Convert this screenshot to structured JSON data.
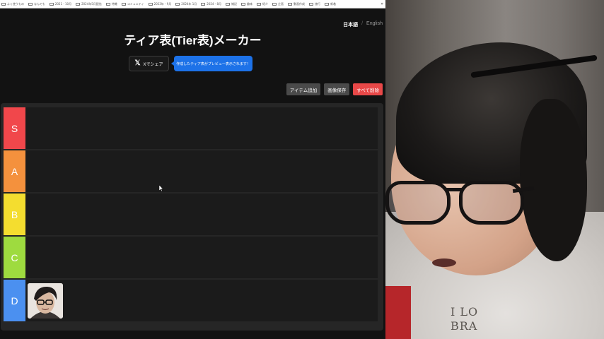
{
  "bookmarks": {
    "items": [
      "よく使うもの",
      "なんでも",
      "2021 - 10月",
      "2024年5月配信",
      "待機",
      "コミュニティ",
      "2023年 - 9月",
      "2024年 1月",
      "2024 - 8月",
      "雑記",
      "趣味",
      "紹介",
      "企画",
      "動画作成",
      "旅行",
      "新着"
    ],
    "more": "»"
  },
  "lang": {
    "japanese": "日本語",
    "separator": "/",
    "english": "English"
  },
  "page": {
    "title": "ティア表(Tier表)メーカー"
  },
  "share": {
    "icon_glyph": "𝕏",
    "label": "Xでシェア"
  },
  "tooltip": {
    "text": "作成したティア表がプレビュー表示されます！"
  },
  "toolbar": {
    "add": "アイテム追加",
    "save": "画像保存",
    "delete_all": "すべて削除"
  },
  "tiers": [
    {
      "label": "S",
      "color": "#f1474b"
    },
    {
      "label": "A",
      "color": "#f4913d"
    },
    {
      "label": "B",
      "color": "#f4dd2f"
    },
    {
      "label": "C",
      "color": "#9edb3f"
    },
    {
      "label": "D",
      "color": "#4b90f0"
    }
  ],
  "items": {
    "d_tier_avatar": "man-with-glasses-avatar"
  },
  "webcam": {
    "shirt_text_line1": "I LO",
    "shirt_text_line2": "BRA"
  }
}
